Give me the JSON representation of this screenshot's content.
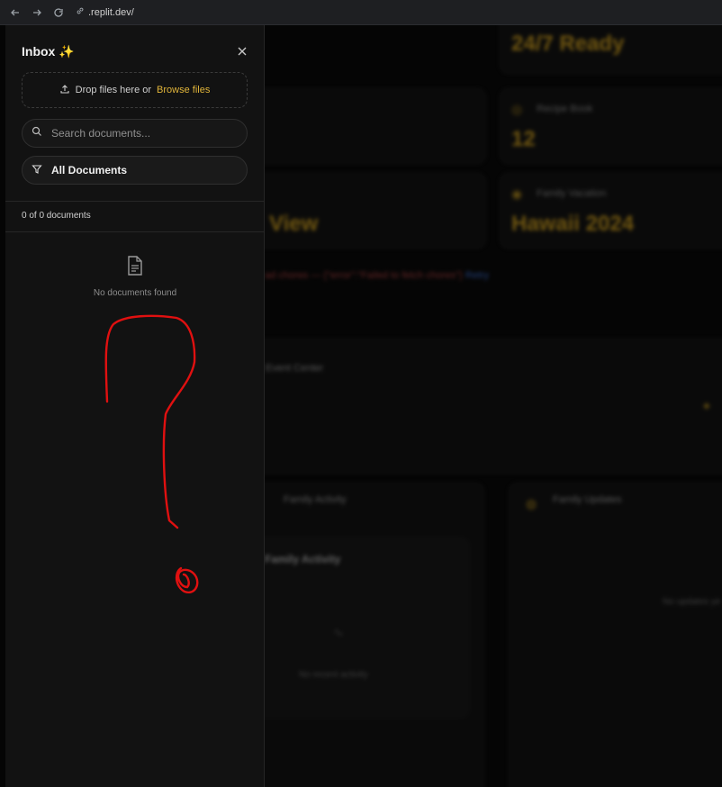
{
  "browser": {
    "url": ".replit.dev/"
  },
  "background": {
    "cards": [
      {
        "value": "24/7 Ready"
      },
      {
        "label": "Recipe Book",
        "value": "12"
      },
      {
        "label": "Family Vacation",
        "value": "Hawaii 2024"
      }
    ],
    "partial_view": "View",
    "error_text": "ad chores — {\"error\":\"Failed to fetch chores\"}",
    "error_link": "Retry",
    "event_center": "Event Center",
    "family_activity": "Family Activity",
    "family_updates": "Family Updates",
    "no_recent_activity": "No recent activity",
    "no_updates": "No updates ye"
  },
  "inbox": {
    "title": "Inbox ✨",
    "drop_text": "Drop files here or",
    "browse_label": "Browse files",
    "search_placeholder": "Search documents...",
    "filter_label": "All Documents",
    "count_text": "0 of 0 documents",
    "empty_text": "No documents found"
  },
  "colors": {
    "accent": "#e0b43a",
    "annotation": "#e01010"
  }
}
